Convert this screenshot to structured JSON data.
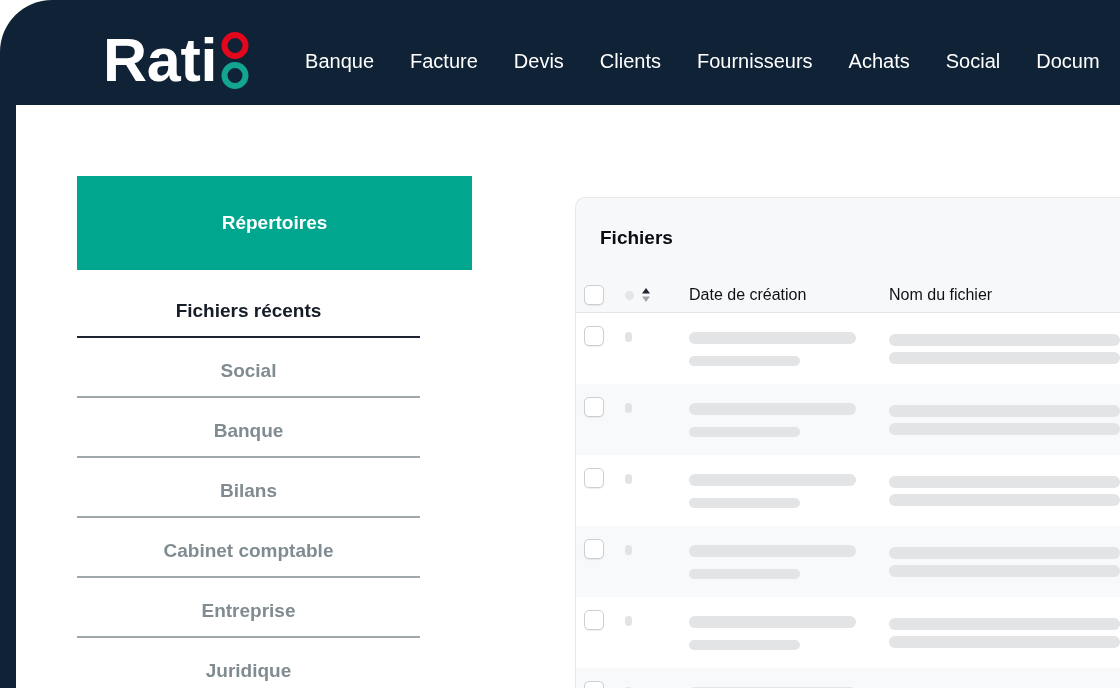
{
  "logo": {
    "text": "Rati"
  },
  "nav": [
    "Banque",
    "Facture",
    "Devis",
    "Clients",
    "Fournisseurs",
    "Achats",
    "Social",
    "Docum"
  ],
  "sidebar": {
    "button": "Répertoires",
    "items": [
      {
        "label": "Fichiers récents",
        "selected": true
      },
      {
        "label": "Social",
        "selected": false
      },
      {
        "label": "Banque",
        "selected": false
      },
      {
        "label": "Bilans",
        "selected": false
      },
      {
        "label": "Cabinet comptable",
        "selected": false
      },
      {
        "label": "Entreprise",
        "selected": false
      },
      {
        "label": "Juridique",
        "selected": false
      }
    ]
  },
  "table": {
    "title": "Fichiers",
    "select_all": {
      "checked": false
    },
    "sorted_ascending": true,
    "columns": [
      "Date de création",
      "Nom du fichier"
    ],
    "loading": true,
    "rows": [
      {
        "checked": false
      },
      {
        "checked": false
      },
      {
        "checked": false
      },
      {
        "checked": false
      },
      {
        "checked": false
      },
      {
        "checked": false
      }
    ]
  }
}
